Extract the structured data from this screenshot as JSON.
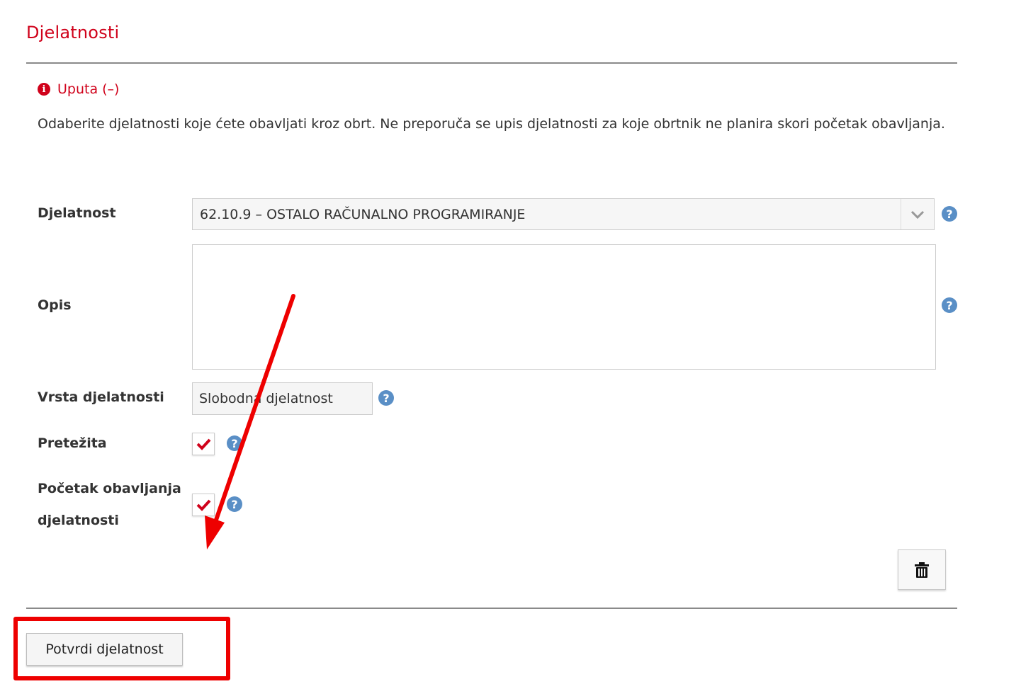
{
  "section": {
    "title": "Djelatnosti"
  },
  "instructions": {
    "toggle_label": "Uputa (–)",
    "text": "Odaberite djelatnosti koje ćete obavljati kroz obrt. Ne preporuča se upis djelatnosti za koje obrtnik ne planira skori početak obavljanja."
  },
  "form": {
    "djelatnost": {
      "label": "Djelatnost",
      "value": "62.10.9 – OSTALO RAČUNALNO PROGRAMIRANJE"
    },
    "opis": {
      "label": "Opis",
      "value": ""
    },
    "vrsta": {
      "label": "Vrsta djelatnosti",
      "value": "Slobodna djelatnost"
    },
    "pretezita": {
      "label": "Pretežita",
      "checked": true
    },
    "pocetak": {
      "label_line1": "Početak obavljanja",
      "label_line2": "djelatnosti",
      "checked": true
    },
    "help_glyph": "?"
  },
  "actions": {
    "confirm_label": "Potvrdi djelatnost"
  },
  "icons": {
    "info": "info-icon",
    "help": "question-circle-icon",
    "dropdown": "chevron-down-icon",
    "checkbox": "checkmark-icon",
    "delete": "trash-icon"
  },
  "colors": {
    "accent": "#d0021b",
    "help": "#5a8fc6",
    "annotation": "#ee0000"
  }
}
